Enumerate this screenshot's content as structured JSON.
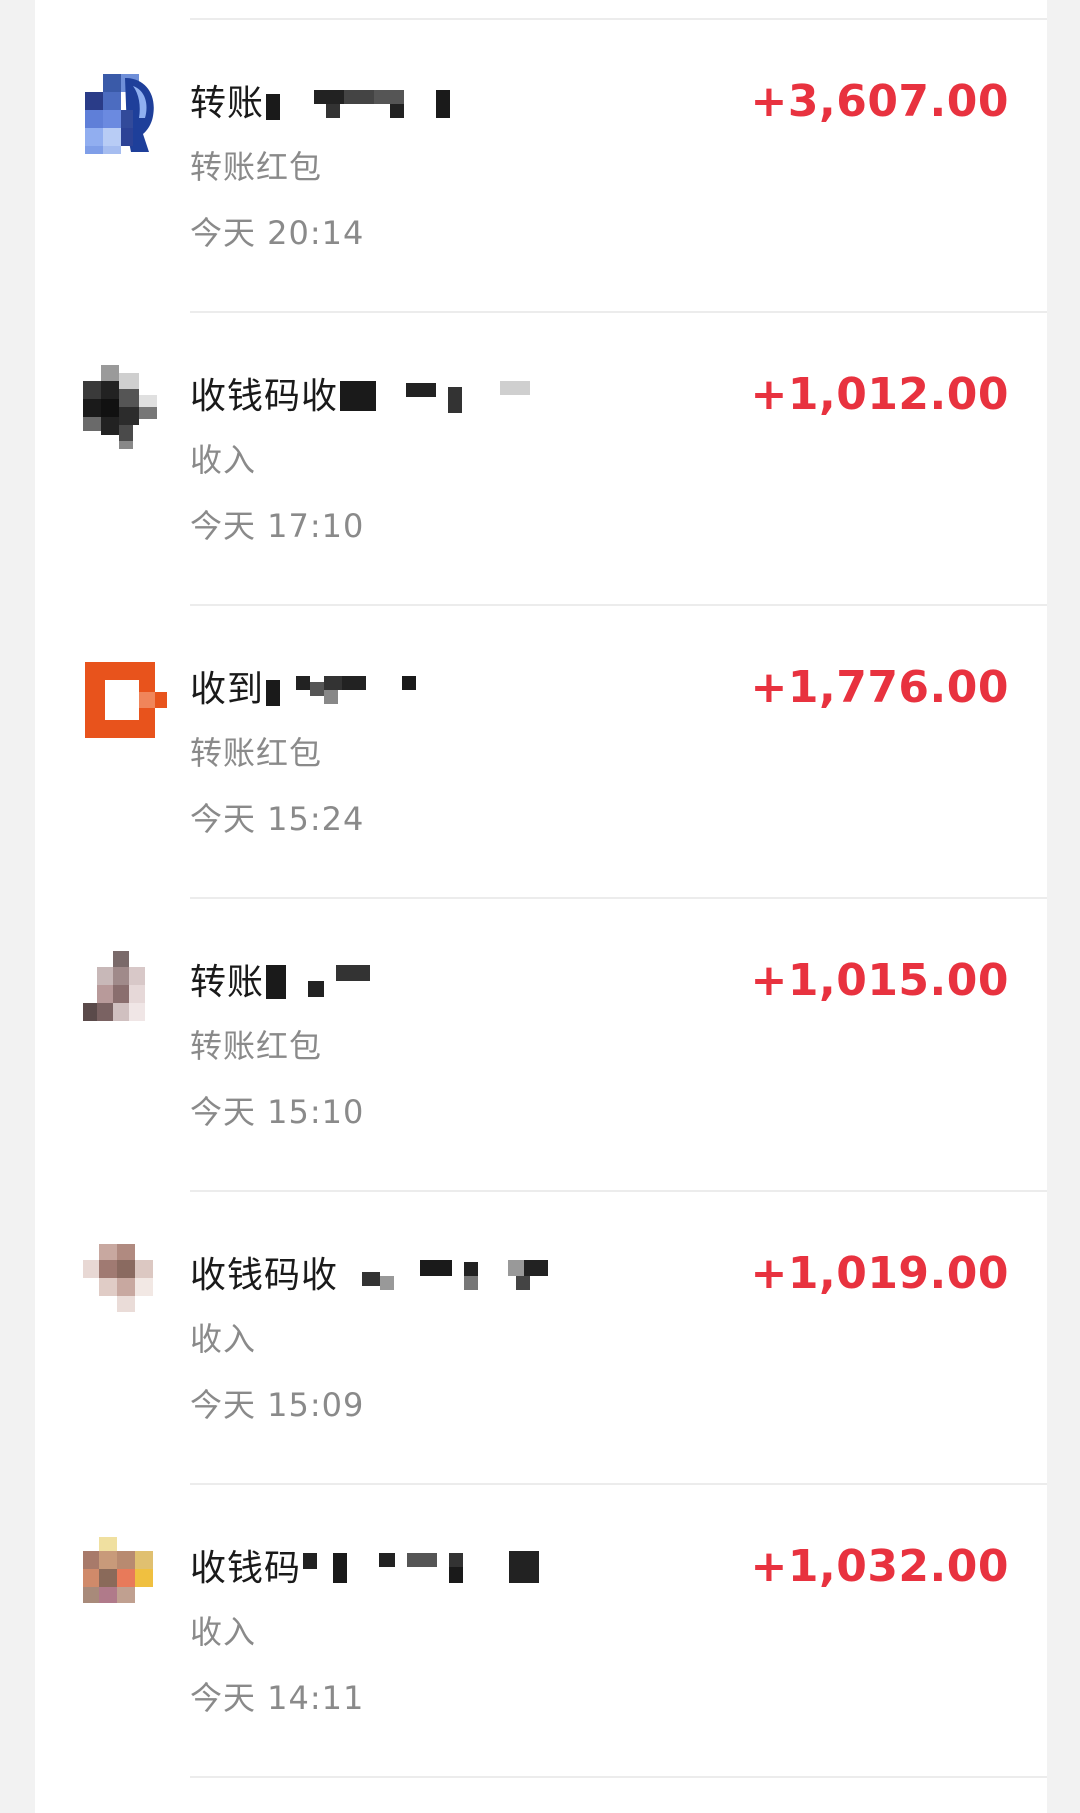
{
  "transactions": [
    {
      "title": "转账",
      "category": "转账红包",
      "time": "今天 20:14",
      "amount": "+3,607.00",
      "avatar_icon": "pixelated-portrait-icon"
    },
    {
      "title": "收钱码收",
      "category": "收入",
      "time": "今天 17:10",
      "amount": "+1,012.00",
      "avatar_icon": "pixelated-avatar-icon"
    },
    {
      "title": "收到",
      "category": "转账红包",
      "time": "今天 15:24",
      "amount": "+1,776.00",
      "avatar_icon": "orange-square-logo-icon"
    },
    {
      "title": "转账",
      "category": "转账红包",
      "time": "今天 15:10",
      "amount": "+1,015.00",
      "avatar_icon": "pixelated-avatar-icon"
    },
    {
      "title": "收钱码收",
      "category": "收入",
      "time": "今天 15:09",
      "amount": "+1,019.00",
      "avatar_icon": "pixelated-avatar-icon"
    },
    {
      "title": "收钱码",
      "category": "收入",
      "time": "今天 14:11",
      "amount": "+1,032.00",
      "avatar_icon": "pixelated-avatar-icon"
    }
  ],
  "colors": {
    "amount": "#e8323f",
    "secondary_text": "#8a8a8a",
    "primary_text": "#1a1a1a",
    "background": "#f2f2f2",
    "card": "#ffffff"
  }
}
